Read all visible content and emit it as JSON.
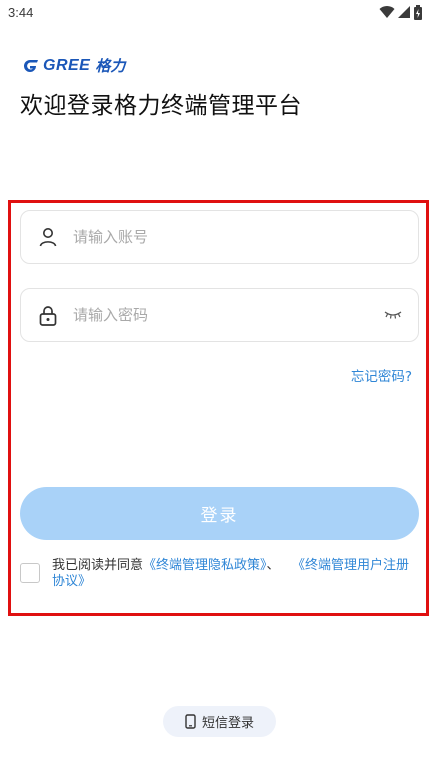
{
  "status_bar": {
    "time": "3:44"
  },
  "header": {
    "logo_text": "GREE",
    "logo_cn": "格力",
    "welcome": "欢迎登录格力终端管理平台"
  },
  "form": {
    "account_placeholder": "请输入账号",
    "account_value": "",
    "password_placeholder": "请输入密码",
    "password_value": "",
    "forgot_label": "忘记密码?",
    "login_label": "登录",
    "agreement": {
      "prefix": "我已阅读并同意",
      "privacy_link": "《终端管理隐私政策》",
      "separator": "、",
      "user_link": "《终端管理用户注册协议》"
    }
  },
  "footer": {
    "sms_login_label": "短信登录"
  },
  "colors": {
    "brand": "#1b57b8",
    "link": "#2f86d6",
    "login_button": "#a9d2f8",
    "highlight_frame": "#e01010"
  }
}
